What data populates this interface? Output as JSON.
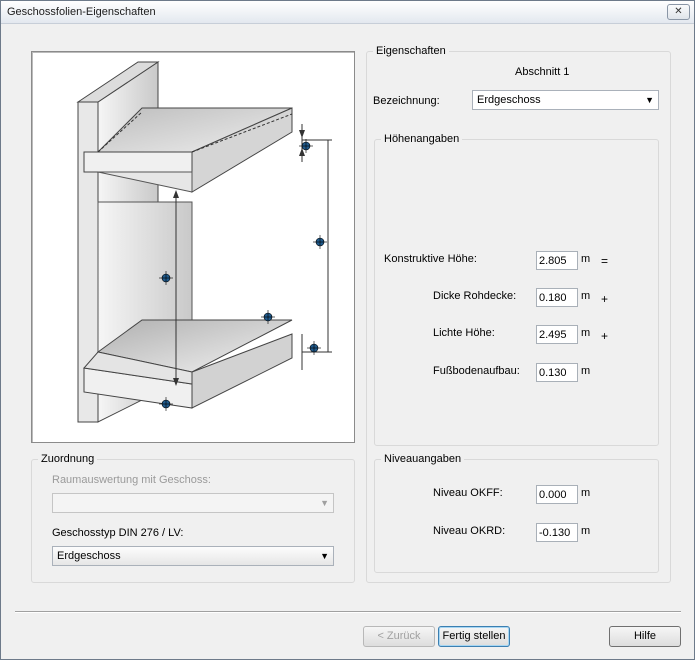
{
  "window": {
    "title": "Geschossfolien-Eigenschaften",
    "close_glyph": "✕"
  },
  "eigenschaften": {
    "legend": "Eigenschaften",
    "section": "Abschnitt 1",
    "bezeichnung_label": "Bezeichnung:",
    "bezeichnung_value": "Erdgeschoss"
  },
  "hoehen": {
    "legend": "Höhenangaben",
    "rows": [
      {
        "label": "Konstruktive Höhe:",
        "value": "2.805",
        "unit": "m",
        "op": "="
      },
      {
        "label": "Dicke Rohdecke:",
        "value": "0.180",
        "unit": "m",
        "op": "+"
      },
      {
        "label": "Lichte Höhe:",
        "value": "2.495",
        "unit": "m",
        "op": "+"
      },
      {
        "label": "Fußbodenaufbau:",
        "value": "0.130",
        "unit": "m",
        "op": ""
      }
    ]
  },
  "niveau": {
    "legend": "Niveauangaben",
    "rows": [
      {
        "label": "Niveau OKFF:",
        "value": "0.000",
        "unit": "m"
      },
      {
        "label": "Niveau OKRD:",
        "value": "-0.130",
        "unit": "m"
      }
    ]
  },
  "zuordnung": {
    "legend": "Zuordnung",
    "raum_label": "Raumauswertung mit Geschoss:",
    "raum_value": "",
    "typ_label": "Geschosstyp DIN 276 / LV:",
    "typ_value": "Erdgeschoss"
  },
  "buttons": {
    "back": "< Zurück",
    "finish": "Fertig stellen",
    "help": "Hilfe"
  },
  "icons": {
    "dropdown": "▼"
  }
}
